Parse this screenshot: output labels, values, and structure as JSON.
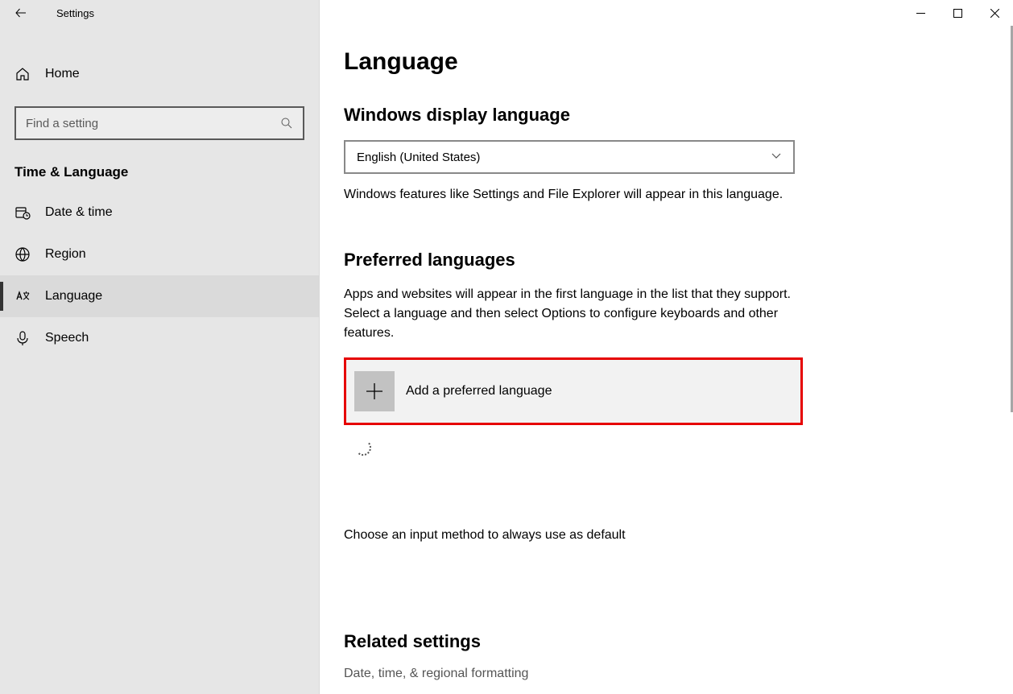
{
  "window": {
    "title": "Settings"
  },
  "sidebar": {
    "home_label": "Home",
    "search_placeholder": "Find a setting",
    "section_header": "Time & Language",
    "items": [
      {
        "label": "Date & time"
      },
      {
        "label": "Region"
      },
      {
        "label": "Language"
      },
      {
        "label": "Speech"
      }
    ]
  },
  "main": {
    "page_title": "Language",
    "display_lang": {
      "title": "Windows display language",
      "selected": "English (United States)",
      "description": "Windows features like Settings and File Explorer will appear in this language."
    },
    "preferred": {
      "title": "Preferred languages",
      "description": "Apps and websites will appear in the first language in the list that they support. Select a language and then select Options to configure keyboards and other features.",
      "add_label": "Add a preferred language"
    },
    "input_method_link": "Choose an input method to always use as default",
    "related": {
      "title": "Related settings",
      "link1": "Date, time, & regional formatting"
    }
  }
}
